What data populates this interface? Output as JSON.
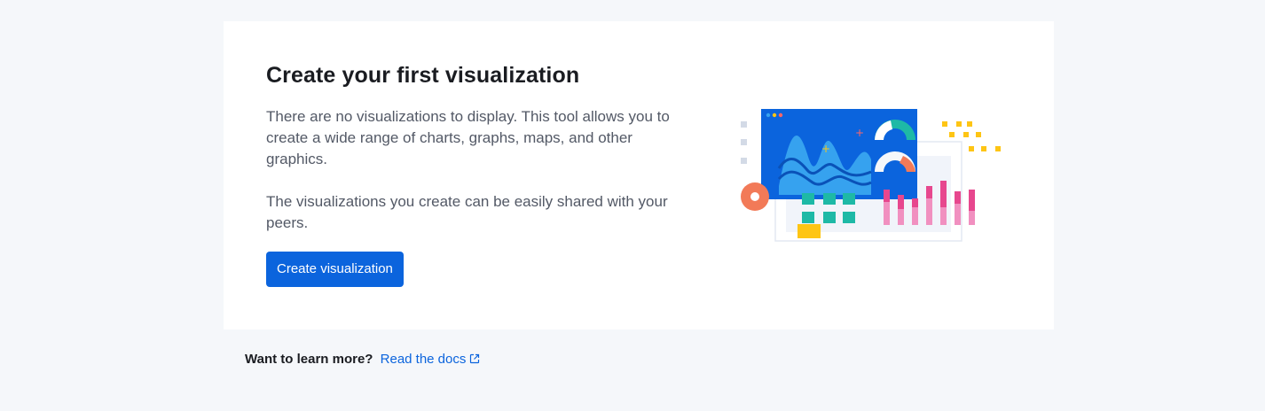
{
  "empty_state": {
    "title": "Create your first visualization",
    "description_1": "There are no visualizations to display. This tool allows you to create a wide range of charts, graphs, maps, and other graphics.",
    "description_2": "The visualizations you create can be easily shared with your peers.",
    "create_button_label": "Create visualization",
    "illustration_icon": "visualization-illustration"
  },
  "footer": {
    "prompt": "Want to learn more?",
    "docs_link_label": "Read the docs",
    "docs_link_icon": "external-link-icon"
  },
  "colors": {
    "accent": "#0b64dd",
    "title_text": "#1a1c21",
    "body_text": "#535966",
    "page_background": "#f5f7fa",
    "panel_background": "#ffffff"
  }
}
